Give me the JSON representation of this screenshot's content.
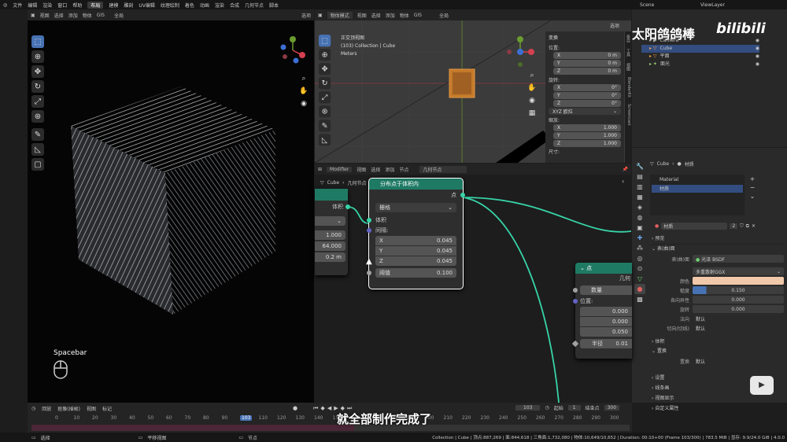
{
  "top_menu": [
    "文件",
    "编辑",
    "渲染",
    "窗口",
    "帮助"
  ],
  "workspaces": [
    "布局",
    "建模",
    "雕刻",
    "UV编辑",
    "纹理绘制",
    "着色",
    "动画",
    "渲染",
    "合成",
    "几何节点",
    "脚本"
  ],
  "active_workspace": "布局",
  "scene": "Scene",
  "view_layer": "ViewLayer",
  "left_viewport": {
    "header": [
      "视图",
      "选择",
      "添加",
      "物体",
      "GIS"
    ],
    "global": "全局",
    "options": "选项",
    "hint": "Spacebar"
  },
  "top_viewport": {
    "mode": "物体模式",
    "header": [
      "视图",
      "选择",
      "添加",
      "物体",
      "GIS"
    ],
    "global": "全局",
    "options": "选项",
    "info_line1": "正交顶视图",
    "info_line2": "(103) Collection | Cube",
    "info_line3": "Meters",
    "transform": {
      "title": "变换",
      "location_label": "位置:",
      "location": [
        [
          "X",
          "0 m"
        ],
        [
          "Y",
          "0 m"
        ],
        [
          "Z",
          "0 m"
        ]
      ],
      "rotation_label": "旋转:",
      "rotation": [
        [
          "X",
          "0°"
        ],
        [
          "Y",
          "0°"
        ],
        [
          "Z",
          "0°"
        ]
      ],
      "rotation_mode": "XYZ 欧拉",
      "scale_label": "缩放:",
      "scale": [
        [
          "X",
          "1.000"
        ],
        [
          "Y",
          "1.000"
        ],
        [
          "Z",
          "1.000"
        ]
      ],
      "dimensions_label": "尺寸:"
    },
    "side_tabs": [
      "条目",
      "工具",
      "视图",
      "BlenderKit",
      "Screencast"
    ]
  },
  "watermark": "太阳鸽鸽棒",
  "bilibili": "bilibili",
  "outliner": {
    "items": [
      {
        "name": "Camera"
      },
      {
        "name": "Cube"
      },
      {
        "name": "平面"
      },
      {
        "name": "面光"
      }
    ]
  },
  "properties": {
    "breadcrumb_obj": "Cube",
    "breadcrumb_tab": "材质",
    "slots": [
      "Material",
      "材质"
    ],
    "material_name": "材质",
    "material_users": "2",
    "sections": {
      "preview": "预览",
      "surface": "表(曲)面",
      "volume": "体积",
      "displacement": "置换",
      "settings": "设置",
      "lineart": "线条画",
      "viewport_display": "视图显示",
      "custom_props": "自定义属性"
    },
    "surface_label": "表(曲)面",
    "shader": "光泽 BSDF",
    "distribution": "多重散射GGX",
    "rows": [
      {
        "label": "颜色",
        "value": ""
      },
      {
        "label": "糙度",
        "value": "0.150"
      },
      {
        "label": "各向异性",
        "value": "0.000"
      },
      {
        "label": "旋转",
        "value": "0.000"
      },
      {
        "label": "法向",
        "value": "默认"
      },
      {
        "label": "切向(切线)",
        "value": "默认"
      }
    ],
    "displacement_label": "置换",
    "displacement_value": "默认",
    "color_swatch": "#f0c8aa"
  },
  "node_editor": {
    "header": [
      "视图",
      "选择",
      "添加",
      "节点"
    ],
    "modifier": "Modifier",
    "nodetree": "几何节点",
    "breadcrumb": [
      "Cube",
      "几何节点"
    ],
    "node_left": {
      "socket": "体积",
      "dropdown": "",
      "values": [
        "1.000",
        "64.000",
        "0.2 m"
      ]
    },
    "node_main": {
      "title": "分布点于体积内",
      "output": "点",
      "mode": "栅格",
      "input_volume": "体积",
      "spacing_label": "间隔:",
      "spacing": [
        [
          "X",
          "0.045"
        ],
        [
          "Y",
          "0.045"
        ],
        [
          "Z",
          "0.045"
        ]
      ],
      "threshold_label": "阈值",
      "threshold": "0.100"
    },
    "node_right": {
      "title": "点",
      "output": "几何",
      "count_label": "数量",
      "position_label": "位置:",
      "position": [
        "0.000",
        "0.000",
        "0.050"
      ],
      "radius_label": "半径",
      "radius": "0.01"
    }
  },
  "timeline": {
    "menus": [
      "回放",
      "抠像(插帧)",
      "视图",
      "标记"
    ],
    "current_frame": "103",
    "start_label": "起始",
    "start": "1",
    "end_label": "结束点",
    "end": "300",
    "ticks": [
      "0",
      "10",
      "20",
      "30",
      "40",
      "50",
      "60",
      "70",
      "80",
      "90",
      "103",
      "110",
      "120",
      "130",
      "140",
      "150",
      "160",
      "170",
      "180",
      "190",
      "200",
      "210",
      "220",
      "230",
      "240",
      "250",
      "260",
      "270",
      "280",
      "290",
      "300"
    ]
  },
  "subtitle": "就全部制作完成了",
  "status": {
    "select": "选择",
    "pan": "平移视图",
    "node": "节点",
    "stats": "Collection | Cube | 顶点:887,269 | 面:844,618 | 三角面:1,732,080 | 物体:10,649/10,652 | Duration: 00:10+00 (Frame 103/300) | 783.5 MiB | 显存: 9.9/24.0 GiB | 4.0.0"
  }
}
